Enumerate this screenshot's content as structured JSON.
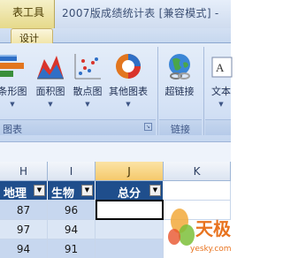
{
  "titlebar": {
    "context_tab": "表工具",
    "title": "2007版成绩统计表 [兼容模式] -"
  },
  "tabs": {
    "design": "设计"
  },
  "ribbon": {
    "buttons": [
      {
        "label": "条形图",
        "icon": "bar-chart-icon"
      },
      {
        "label": "面积图",
        "icon": "area-chart-icon"
      },
      {
        "label": "散点图",
        "icon": "scatter-chart-icon"
      },
      {
        "label": "其他图表",
        "icon": "other-chart-icon"
      },
      {
        "label": "超链接",
        "icon": "hyperlink-globe-icon"
      },
      {
        "label": "文本",
        "icon": "text-box-icon"
      }
    ],
    "groups": {
      "charts": "图表",
      "links": "链接"
    }
  },
  "sheet": {
    "columns": [
      "H",
      "I",
      "J",
      "K"
    ],
    "headers": [
      "地理",
      "生物",
      "总分"
    ],
    "rows": [
      [
        "87",
        "96",
        ""
      ],
      [
        "97",
        "94",
        ""
      ],
      [
        "94",
        "91",
        ""
      ]
    ]
  },
  "watermark": {
    "brand": "天极",
    "url": "yesky.com"
  },
  "colors": {
    "header_fill": "#1f4e8c",
    "row_band_1": "#c7d7ef",
    "row_band_2": "#dbe6f5",
    "ribbon": "#d6e3f6"
  }
}
